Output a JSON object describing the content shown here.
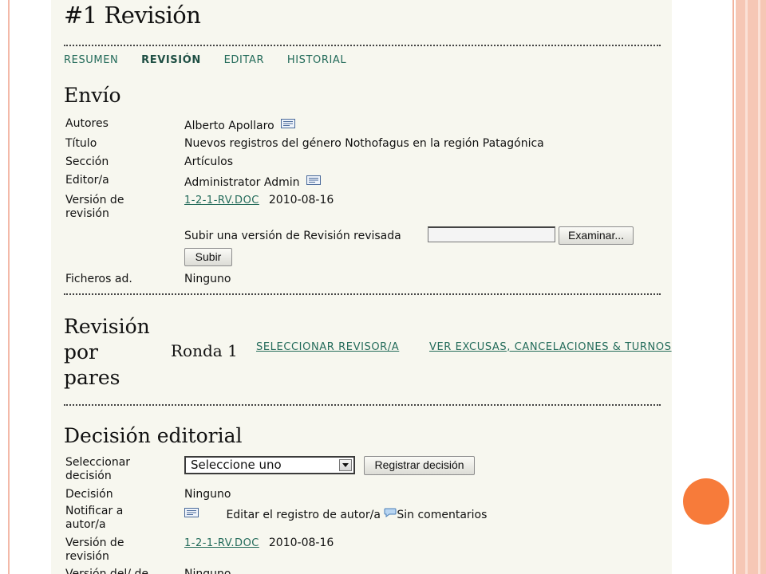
{
  "page_title": "#1 Revisión",
  "tabs": [
    {
      "label": "RESUMEN",
      "active": false
    },
    {
      "label": "REVISIÓN",
      "active": true
    },
    {
      "label": "EDITAR",
      "active": false
    },
    {
      "label": "HISTORIAL",
      "active": false
    }
  ],
  "envio": {
    "heading": "Envío",
    "autores_label": "Autores",
    "autores_value": "Alberto Apollaro",
    "titulo_label": "Título",
    "titulo_value": "Nuevos registros del género Nothofagus en la región Patagónica",
    "seccion_label": "Sección",
    "seccion_value": "Artículos",
    "editor_label": "Editor/a",
    "editor_value": "Administrator Admin",
    "version_label": "Versión de revisión",
    "version_file": "1-2-1-RV.DOC",
    "version_date": "2010-08-16",
    "upload_label": "Subir una versión de Revisión revisada",
    "browse_button": "Examinar...",
    "submit_button": "Subir",
    "ficheros_label": "Ficheros ad.",
    "ficheros_value": "Ninguno"
  },
  "peer_review": {
    "heading_line1": "Revisión",
    "heading_line2": "por",
    "heading_line3": "pares",
    "round": "Ronda 1",
    "select_reviewer_link": "SELECCIONAR REVISOR/A",
    "excuses_link": "VER EXCUSAS, CANCELACIONES & TURNOS"
  },
  "decision": {
    "heading": "Decisión editorial",
    "select_label": "Seleccionar decisión",
    "select_value": "Seleccione uno",
    "register_button": "Registrar decisión",
    "decision_label": "Decisión",
    "decision_value": "Ninguno",
    "notify_label": "Notificar a autor/a",
    "edit_log_text": "Editar el registro de autor/a",
    "comments_text": "Sin comentarios",
    "version_label": "Versión de revisión",
    "version_file": "1-2-1-RV.DOC",
    "version_date": "2010-08-16",
    "cutoff_label": "Versión del/ de",
    "cutoff_value": "Ninguno"
  },
  "colors": {
    "link": "#236b5a",
    "page_bg": "#f7f7ef",
    "slide_accent": "#f77b3a",
    "frame": "#f6c7b5"
  }
}
